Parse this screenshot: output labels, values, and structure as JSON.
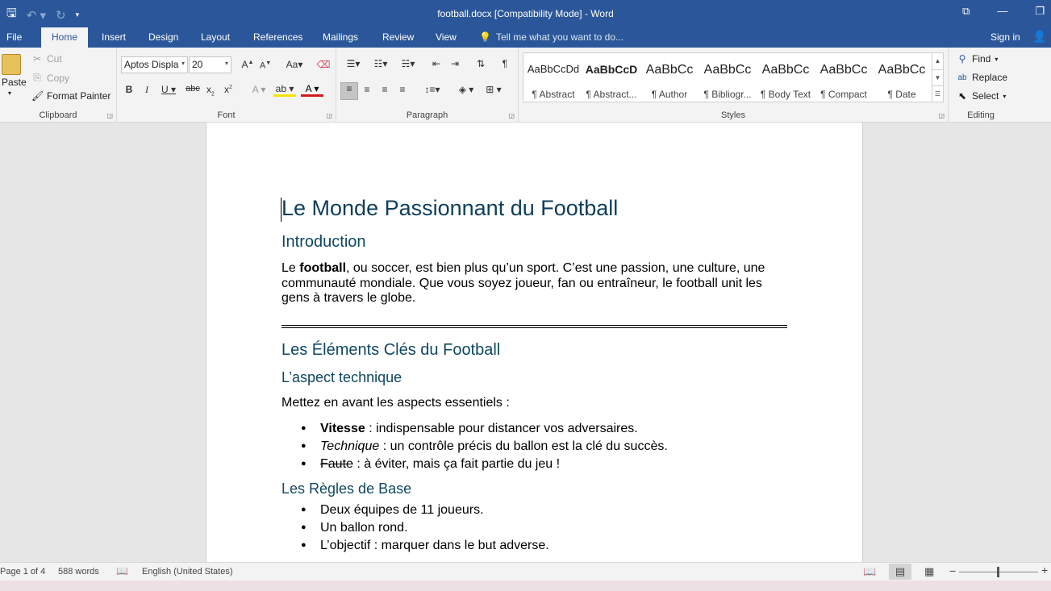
{
  "titlebar": {
    "title": "football.docx [Compatibility Mode] - Word"
  },
  "tabs": {
    "file": "File",
    "home": "Home",
    "insert": "Insert",
    "design": "Design",
    "layout": "Layout",
    "references": "References",
    "mailings": "Mailings",
    "review": "Review",
    "view": "View",
    "tellme": "Tell me what you want to do...",
    "signin": "Sign in"
  },
  "clipboard": {
    "paste": "Paste",
    "cut": "Cut",
    "copy": "Copy",
    "format_painter": "Format Painter",
    "label": "Clipboard"
  },
  "font": {
    "name": "Aptos Displa",
    "size": "20",
    "label": "Font"
  },
  "paragraph": {
    "label": "Paragraph"
  },
  "styles": {
    "label": "Styles",
    "items": [
      {
        "preview": "AaBbCcDd",
        "name": "¶ Abstract"
      },
      {
        "preview": "AaBbCcD",
        "name": "¶ Abstract..."
      },
      {
        "preview": "AaBbCc",
        "name": "¶ Author"
      },
      {
        "preview": "AaBbCc",
        "name": "¶ Bibliogr..."
      },
      {
        "preview": "AaBbCc",
        "name": "¶ Body Text"
      },
      {
        "preview": "AaBbCc",
        "name": "¶ Compact"
      },
      {
        "preview": "AaBbCc",
        "name": "¶ Date"
      }
    ]
  },
  "editing": {
    "find": "Find",
    "replace": "Replace",
    "select": "Select",
    "label": "Editing"
  },
  "doc": {
    "title": "Le Monde Passionnant du Football",
    "h_intro": "Introduction",
    "intro_pre": "Le ",
    "intro_bold": "football",
    "intro_rest": ", ou soccer, est bien plus qu’un sport. C’est une passion, une culture, une communauté mondiale. Que vous soyez joueur, fan ou entraîneur, le football unit les gens à travers le globe.",
    "h_elements": "Les Éléments Clés du Football",
    "h_tech": "L’aspect technique",
    "tech_intro": "Mettez en avant les aspects essentiels :",
    "b1_term": "Vitesse",
    "b1_text": " : indispensable pour distancer vos adversaires.",
    "b2_term": "Technique",
    "b2_text": " : un contrôle précis du ballon est la clé du succès.",
    "b3_term": "Faute",
    "b3_text": " : à éviter, mais ça fait partie du jeu !",
    "h_rules": "Les Règles de Base",
    "r1": "Deux équipes de 11 joueurs.",
    "r2": "Un ballon rond.",
    "r3": "L’objectif : marquer dans le but adverse."
  },
  "status": {
    "page": "Page 1 of 4",
    "words": "588 words",
    "language": "English (United States)"
  }
}
